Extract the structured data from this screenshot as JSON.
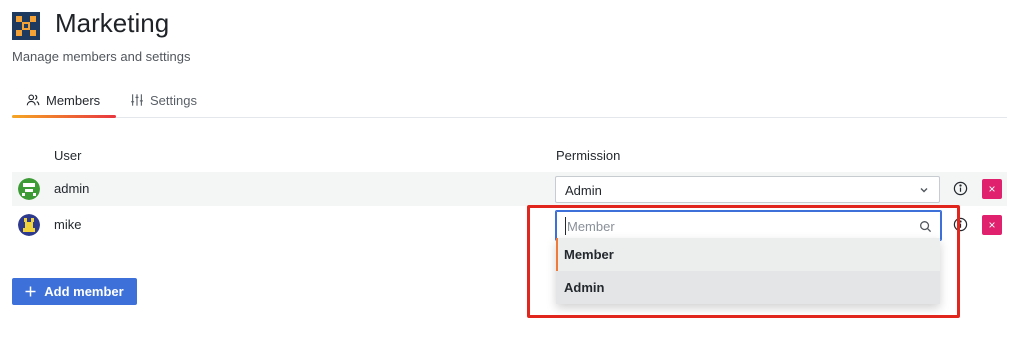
{
  "header": {
    "title": "Marketing",
    "subtitle": "Manage members and settings"
  },
  "tabs": [
    {
      "label": "Members",
      "icon": "users-icon",
      "active": true
    },
    {
      "label": "Settings",
      "icon": "sliders-icon",
      "active": false
    }
  ],
  "table": {
    "columns": [
      "User",
      "Permission"
    ],
    "rows": [
      {
        "user": "admin",
        "permission": "Admin"
      },
      {
        "user": "mike",
        "permission_placeholder": "Member"
      }
    ]
  },
  "dropdown": {
    "options": [
      "Member",
      "Admin"
    ]
  },
  "actions": {
    "add_member": "Add member",
    "delete_glyph": "×"
  },
  "colors": {
    "accent": "#3d71d9",
    "danger": "#e0226e",
    "highlight": "#e0261d",
    "tab_gradient": [
      "#f5a623",
      "#e8363f"
    ]
  }
}
